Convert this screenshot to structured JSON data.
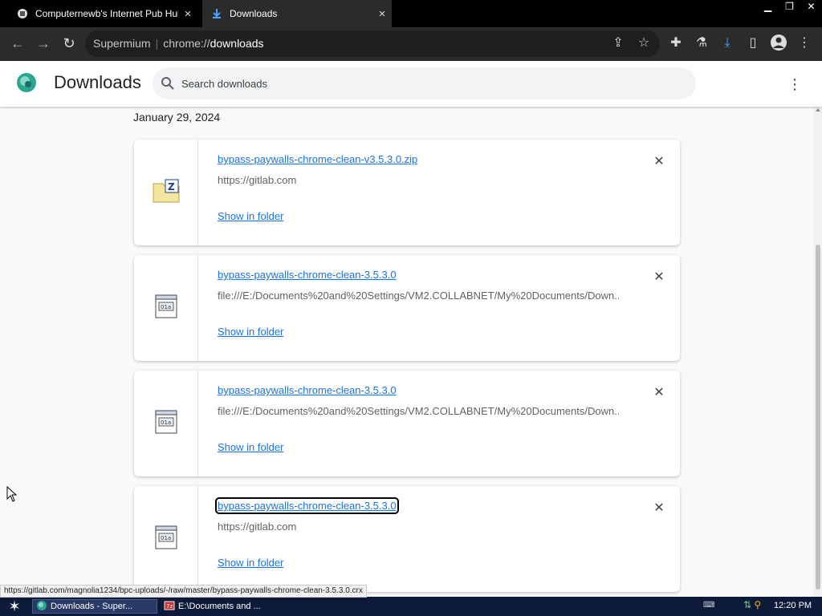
{
  "browser": {
    "tabs": [
      {
        "label": "Computernewb's Internet Pub Hub!",
        "active": false
      },
      {
        "label": "Downloads",
        "active": true
      }
    ],
    "window_controls": [
      "minimize",
      "restore",
      "close"
    ],
    "omnibox": {
      "brand": "Supermium",
      "scheme": "chrome://",
      "host": "downloads"
    }
  },
  "downloads_page": {
    "title": "Downloads",
    "search_placeholder": "Search downloads",
    "date_heading": "January 29, 2024",
    "show_in_folder_label": "Show in folder",
    "items": [
      {
        "name": "bypass-paywalls-chrome-clean-v3.5.3.0.zip",
        "source": "https://gitlab.com",
        "icon": "zip-archive-icon",
        "focused": false
      },
      {
        "name": "bypass-paywalls-chrome-clean-3.5.3.0",
        "source": "file:///E:/Documents%20and%20Settings/VM2.COLLABNET/My%20Documents/Down...",
        "icon": "generic-file-icon",
        "focused": false
      },
      {
        "name": "bypass-paywalls-chrome-clean-3.5.3.0",
        "source": "file:///E:/Documents%20and%20Settings/VM2.COLLABNET/My%20Documents/Down...",
        "icon": "generic-file-icon",
        "focused": false
      },
      {
        "name": "bypass-paywalls-chrome-clean-3.5.3.0",
        "source": "https://gitlab.com",
        "icon": "generic-file-icon",
        "focused": true
      }
    ]
  },
  "status_bar": {
    "link_url": "https://gitlab.com/magnolia1234/bpc-uploads/-/raw/master/bypass-paywalls-chrome-clean-3.5.3.0.crx"
  },
  "taskbar": {
    "tasks": [
      {
        "label": "Downloads - Super..."
      },
      {
        "label": "E:\\Documents and ..."
      }
    ],
    "clock": "12:20 PM"
  },
  "colors": {
    "link": "#1a73e8",
    "tab_strip": "#000000",
    "toolbar": "#2b2b2b",
    "taskbar": "#0d1a3a"
  }
}
